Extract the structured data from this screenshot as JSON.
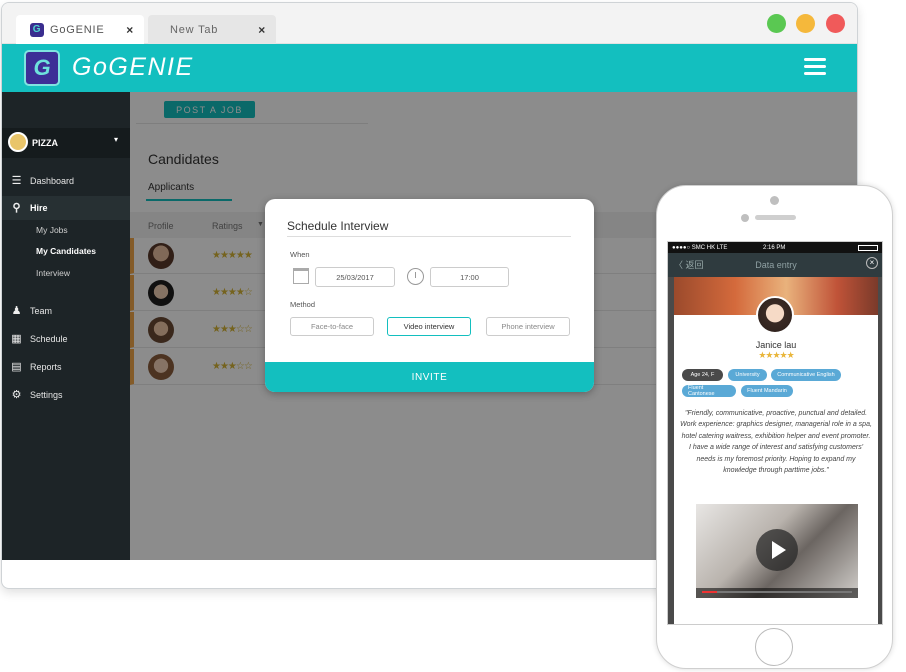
{
  "browser": {
    "tabs": [
      {
        "title": "GoGENIE",
        "favicon": "gogenie-logo-icon",
        "close": "×"
      },
      {
        "title": "New Tab",
        "close": "×"
      }
    ],
    "window_controls": [
      "minimize-dot",
      "maximize-dot",
      "close-dot"
    ],
    "window_control_colors": [
      "#5ac852",
      "#f5b83b",
      "#f05a5a"
    ]
  },
  "app": {
    "brand": "GoGENIE",
    "brand_mark": "G",
    "menu_icon": "hamburger-icon",
    "accent_color": "#13bfbf"
  },
  "sidebar": {
    "org": {
      "name": "PIZZA",
      "caret": "▾"
    },
    "items": [
      {
        "label": "Dashboard",
        "icon": "dashboard-icon"
      },
      {
        "label": "Hire",
        "icon": "search-person-icon"
      },
      {
        "label": "My Jobs"
      },
      {
        "label": "My Candidates"
      },
      {
        "label": "Interview"
      },
      {
        "label": "Team",
        "icon": "team-icon"
      },
      {
        "label": "Schedule",
        "icon": "calendar-icon"
      },
      {
        "label": "Reports",
        "icon": "reports-icon"
      },
      {
        "label": "Settings",
        "icon": "gear-icon"
      }
    ]
  },
  "main": {
    "post_job_label": "POST A JOB",
    "title": "Candidates",
    "tab": "Applicants",
    "columns": {
      "profile": "Profile",
      "ratings": "Ratings"
    },
    "candidates": [
      {
        "rating": 5,
        "stars": "★★★★★"
      },
      {
        "rating": 4,
        "stars": "★★★★☆"
      },
      {
        "rating": 3,
        "stars": "★★★☆☆"
      },
      {
        "rating": 3,
        "stars": "★★★☆☆"
      }
    ]
  },
  "modal": {
    "title": "Schedule Interview",
    "when_label": "When",
    "date": "25/03/2017",
    "time": "17:00",
    "method_label": "Method",
    "methods": [
      "Face-to-face",
      "Video interview",
      "Phone interview"
    ],
    "selected_method": "Video interview",
    "invite_label": "INVITE"
  },
  "phone": {
    "status": {
      "carrier": "●●●●○ SMC HK  LTE",
      "time": "2:16 PM"
    },
    "nav": {
      "back": "〈 返回",
      "title": "Data entry",
      "close": "×"
    },
    "candidate": {
      "name": "Janice lau",
      "stars": "★★★★★",
      "rating": 5,
      "tags": [
        "Age 24, F",
        "University",
        "Communicative English",
        "Fluent Cantonese",
        "Fluent Mandarin"
      ],
      "quote": "\"Friendly, communicative, proactive, punctual and detailed. Work experience: graphics designer, managerial role in a spa, hotel catering waitress, exhibition helper and event promoter. I have a wide range of interest and satisfying customers' needs is my foremost priority. Hoping to expand my knowledge through parttime jobs.\""
    },
    "video": {
      "progress": 0.1
    }
  }
}
